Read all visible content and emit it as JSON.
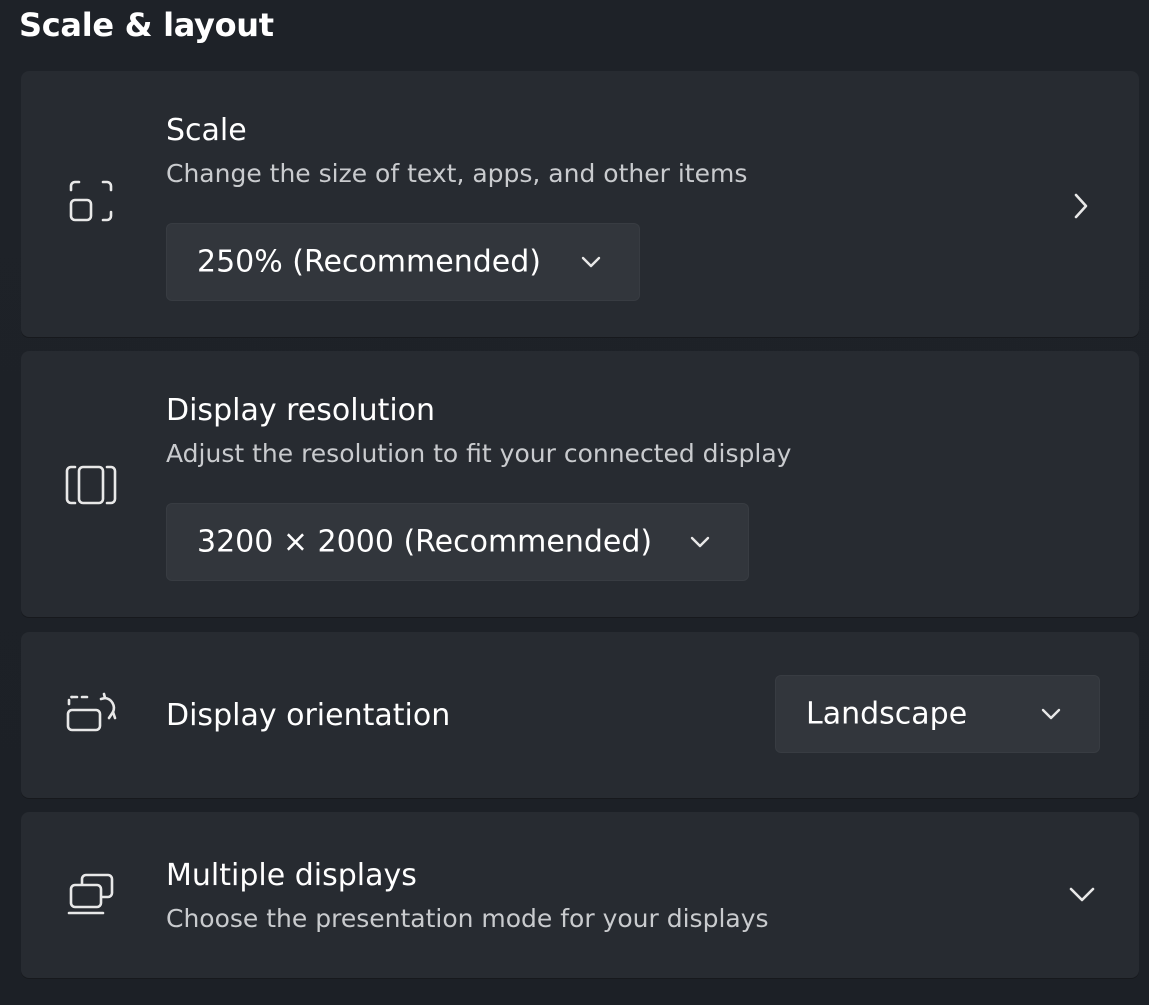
{
  "section": {
    "title": "Scale & layout"
  },
  "scale": {
    "icon": "scale-icon",
    "title": "Scale",
    "description": "Change the size of text, apps, and other items",
    "dropdown_value": "250% (Recommended)"
  },
  "resolution": {
    "icon": "resolution-icon",
    "title": "Display resolution",
    "description": "Adjust the resolution to fit your connected display",
    "dropdown_value": "3200 × 2000 (Recommended)"
  },
  "orientation": {
    "icon": "orientation-icon",
    "title": "Display orientation",
    "dropdown_value": "Landscape"
  },
  "multiple_displays": {
    "icon": "multiple-displays-icon",
    "title": "Multiple displays",
    "description": "Choose the presentation mode for your displays"
  },
  "colors": {
    "background": "#1c2026",
    "card": "#272b31",
    "dropdown": "#32363c",
    "text": "#ffffff",
    "secondary_text": "#c9cbce"
  }
}
